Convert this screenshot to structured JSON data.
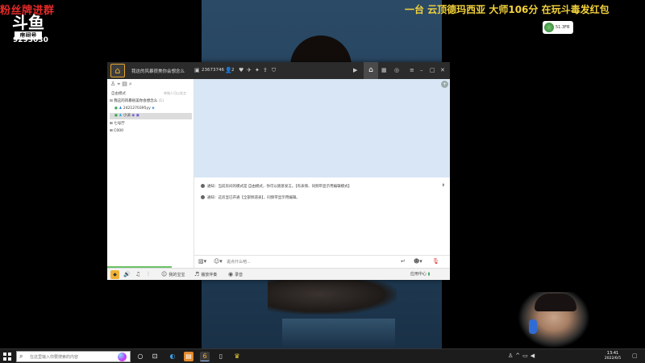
{
  "overlay": {
    "fans": "粉丝牌进群",
    "logo_text": "斗鱼",
    "room_label": "房间号",
    "room_number": "9293030",
    "headline": "一台 云顶德玛西亚 大师106分  在玩斗毒发红包"
  },
  "app": {
    "title": "我这的风暴很美你会想念么",
    "room_id": "23673746",
    "online_count": "2",
    "home_glyph": "⌂",
    "sidebar": {
      "mode_label": "自由模式",
      "mode_tip": "单独人可以发言",
      "tree": [
        {
          "label": "我这的风暴很美你会想念么",
          "count": "(1)",
          "expanded": true
        },
        {
          "label": "2421270395yy",
          "selected": false
        },
        {
          "label": "小派",
          "selected": true
        },
        {
          "label": "七号厅",
          "expanded": false
        },
        {
          "label": "C000",
          "expanded": false
        }
      ]
    },
    "messages": [
      {
        "text": "通知：当前房间的模式是 自由模式，你可以随意发言。【有表情、同频带显示用编辑模式】"
      },
      {
        "text": "通知：这房显已开通【全部频道表】，同频带显示用编辑。"
      }
    ],
    "input_placeholder": "说点什么吧...",
    "bottombar": {
      "item1": "我的宝宝",
      "item2": "播放伴奏",
      "item3": "录音",
      "item4": "应用中心"
    }
  },
  "taskbar": {
    "search_placeholder": "在这里输入你要搜索的内容",
    "time": "13:41",
    "date": "2022/6/5"
  },
  "tray_widget_text": "51.3FB"
}
